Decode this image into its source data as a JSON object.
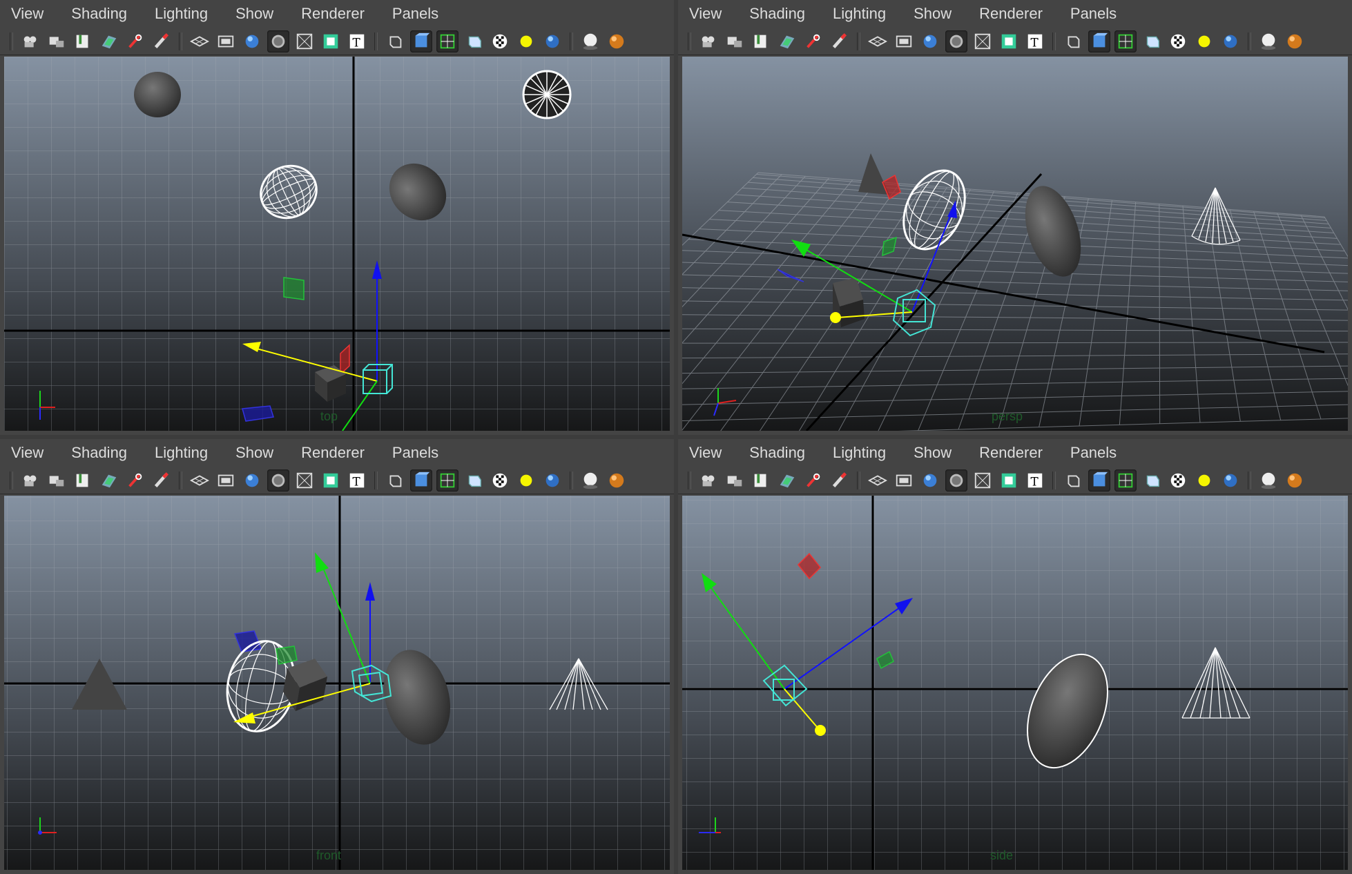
{
  "menus": [
    "View",
    "Shading",
    "Lighting",
    "Show",
    "Renderer",
    "Panels"
  ],
  "toolbar_icons": [
    [
      "camera-select-icon",
      "camera-attributes-icon",
      "bookmarks-icon",
      "image-plane-icon",
      "grease-pencil-icon",
      "2d-pan-zoom-icon"
    ],
    [
      "grid-toggle-icon",
      "film-gate-icon",
      "resolution-gate-icon",
      "gate-mask-icon",
      "field-chart-icon",
      "safe-action-icon",
      "safe-title-icon"
    ],
    [
      "wireframe-icon",
      "smooth-shade-icon",
      "wireframe-on-shaded-icon",
      "default-material-icon",
      "textured-icon",
      "default-lighting-icon",
      "all-lights-icon"
    ],
    [
      "shadows-icon",
      "xray-icon"
    ]
  ],
  "viewports": [
    {
      "name": "top-viewport",
      "camera": "top"
    },
    {
      "name": "persp-viewport",
      "camera": "persp"
    },
    {
      "name": "front-viewport",
      "camera": "front"
    },
    {
      "name": "side-viewport",
      "camera": "side"
    }
  ],
  "colors": {
    "bg_top": "#8592a2",
    "bg_bottom": "#161718",
    "grid": "#9aa0a8",
    "axis": "#000000",
    "selection": "#44e6d6",
    "manip_x": "#ffff00",
    "manip_y": "#11dd11",
    "manip_z": "#1010ff"
  }
}
